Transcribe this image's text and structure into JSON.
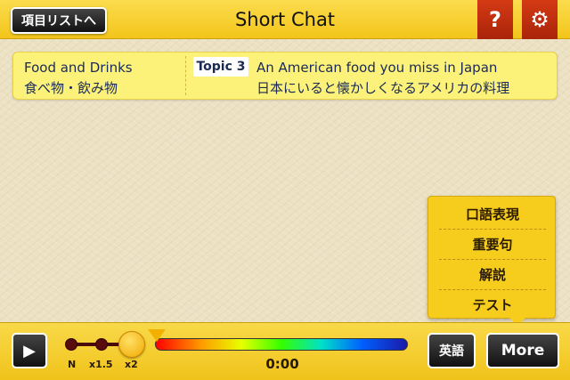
{
  "header": {
    "back_label": "項目リストへ",
    "title": "Short Chat",
    "help_icon": "?",
    "settings_icon": "⚙"
  },
  "topic": {
    "category_en": "Food and Drinks",
    "category_ja": "食べ物・飲み物",
    "badge": "Topic 3",
    "title_en": "An American food you miss in Japan",
    "title_ja": "日本にいると懐かしくなるアメリカの料理"
  },
  "more_menu": {
    "items": [
      "口語表現",
      "重要句",
      "解説",
      "テスト"
    ]
  },
  "player": {
    "play_icon": "▶",
    "speed_labels": [
      "N",
      "x1.5",
      "x2"
    ],
    "selected_speed": "x2",
    "time": "0:00",
    "progress": 0,
    "eng_label": "英語",
    "more_label": "More"
  },
  "colors": {
    "accent_yellow": "#f6cd1d",
    "topic_panel": "#fcf27a",
    "icon_red": "#c42f10"
  }
}
